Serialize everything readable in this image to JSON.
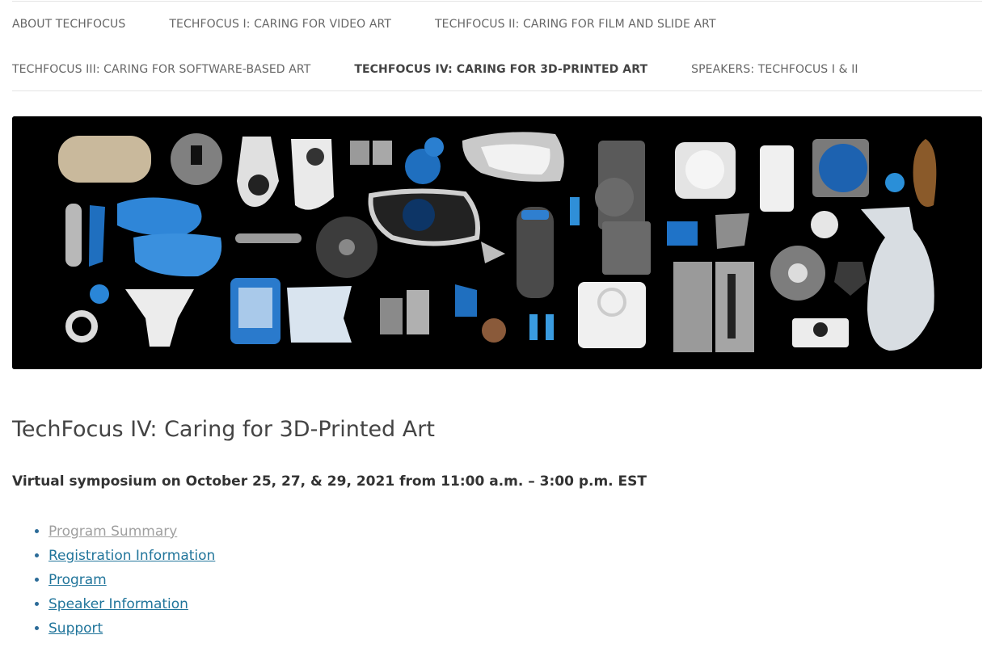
{
  "nav": {
    "items": [
      "ABOUT TECHFOCUS",
      "TECHFOCUS I: CARING FOR VIDEO ART",
      "TECHFOCUS II: CARING FOR FILM AND SLIDE ART",
      "TECHFOCUS III: CARING FOR SOFTWARE-BASED ART",
      "TECHFOCUS IV: CARING FOR 3D-PRINTED ART",
      "SPEAKERS: TECHFOCUS I & II"
    ],
    "current_index": 4
  },
  "page": {
    "title": "TechFocus IV: Caring for 3D-Printed Art",
    "subtitle": "Virtual symposium on October 25, 27, & 29, 2021 from 11:00 a.m. – 3:00 p.m. EST"
  },
  "links": [
    {
      "label": "Program Summary",
      "visited": true
    },
    {
      "label": "Registration Information",
      "visited": false
    },
    {
      "label": "Program",
      "visited": false
    },
    {
      "label": "Speaker Information",
      "visited": false
    },
    {
      "label": "Support",
      "visited": false
    }
  ],
  "colors": {
    "link": "#21759b",
    "visited_link": "#9f9f9f",
    "banner_bg": "#000000",
    "accent_blue": "#1e73c8"
  }
}
